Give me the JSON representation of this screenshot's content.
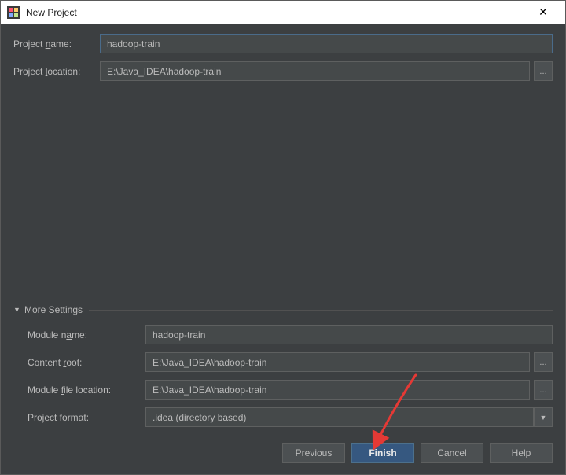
{
  "window": {
    "title": "New Project"
  },
  "top_form": {
    "project_name_label_prefix": "Project ",
    "project_name_label_u": "n",
    "project_name_label_suffix": "ame:",
    "project_name_value": "hadoop-train",
    "project_location_label_prefix": "Project ",
    "project_location_label_u": "l",
    "project_location_label_suffix": "ocation:",
    "project_location_value": "E:\\Java_IDEA\\hadoop-train"
  },
  "more_settings": {
    "header": "More Settings",
    "module_name_label_prefix": "Module n",
    "module_name_label_u": "a",
    "module_name_label_suffix": "me:",
    "module_name_value": "hadoop-train",
    "content_root_label_prefix": "Content ",
    "content_root_label_u": "r",
    "content_root_label_suffix": "oot:",
    "content_root_value": "E:\\Java_IDEA\\hadoop-train",
    "module_file_loc_label_prefix": "Module ",
    "module_file_loc_label_u": "f",
    "module_file_loc_label_suffix": "ile location:",
    "module_file_loc_value": "E:\\Java_IDEA\\hadoop-train",
    "project_format_label": "Project format:",
    "project_format_value": ".idea (directory based)"
  },
  "buttons": {
    "previous": "Previous",
    "finish": "Finish",
    "cancel": "Cancel",
    "help": "Help"
  },
  "icons": {
    "browse": "...",
    "caret_down": "▼",
    "close": "✕"
  }
}
